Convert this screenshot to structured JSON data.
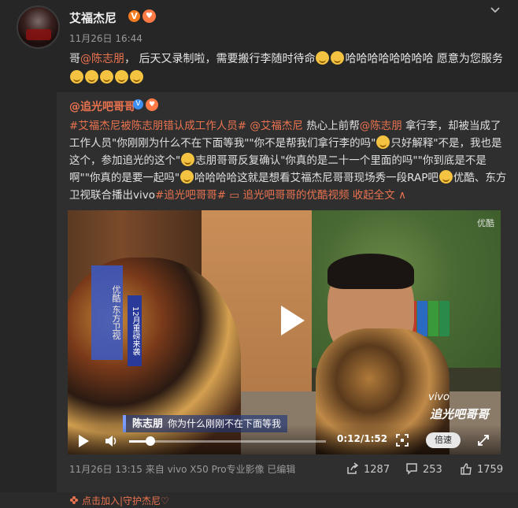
{
  "post": {
    "username": "艾福杰尼",
    "time": "11月26日 16:44",
    "text_a": "哥",
    "mention_a": "@陈志朋",
    "text_b": "， 后天又录制啦，需要搬行李随时待命",
    "text_c": "哈哈哈哈哈哈哈哈 愿意为您服务"
  },
  "repost": {
    "user": "@追光吧哥哥",
    "tag1": "#艾福杰尼被陈志朋错认成工作人员#",
    "mention1": "@艾福杰尼",
    "t1": " 热心上前帮",
    "mention2": "@陈志朋",
    "t2": " 拿行李，却被当成了工作人员\"你刚刚为什么不在下面等我\"\"你不是帮我们拿行李的吗\"",
    "t3": "只好解释\"不是，我也是这个，参加追光的这个\"",
    "t4": "志朋哥哥反复确认\"你真的是二十一个里面的吗\"\"你到底是不是啊\"\"你真的是要一起吗\"",
    "t5": "哈哈哈哈这就是想看艾福杰尼哥哥现场秀一段RAP吧",
    "t6": "优酷、东方卫视联合播出vivo",
    "tag2": "#追光吧哥哥#",
    "video_link": "追光吧哥哥的优酷视频",
    "collapse": "收起全文",
    "collapse_arrow": "∧",
    "video": {
      "watermark": "优酷",
      "logo_text": "优酷 东方卫视",
      "logo_text2": "12月重磅来袭",
      "subtitle_name": "陈志朋",
      "subtitle": "你为什么刚刚不在下面等我",
      "sponsor": "vivo",
      "brand": "追光吧哥哥",
      "current_time": "0:12",
      "duration": "1:52",
      "time_display": "0:12/1:52",
      "progress": 0.107,
      "speed_label": "倍速"
    },
    "meta": "11月26日 13:15 来自 vivo X50 Pro专业影像  已编辑",
    "repost_count": "1287",
    "comment_count": "253",
    "like_count": "1759"
  },
  "footer": {
    "text": "点击加入|守护杰尼♡"
  },
  "colors": {
    "background": "#262626",
    "link": "#eb7350",
    "verified": "#f47b20"
  }
}
